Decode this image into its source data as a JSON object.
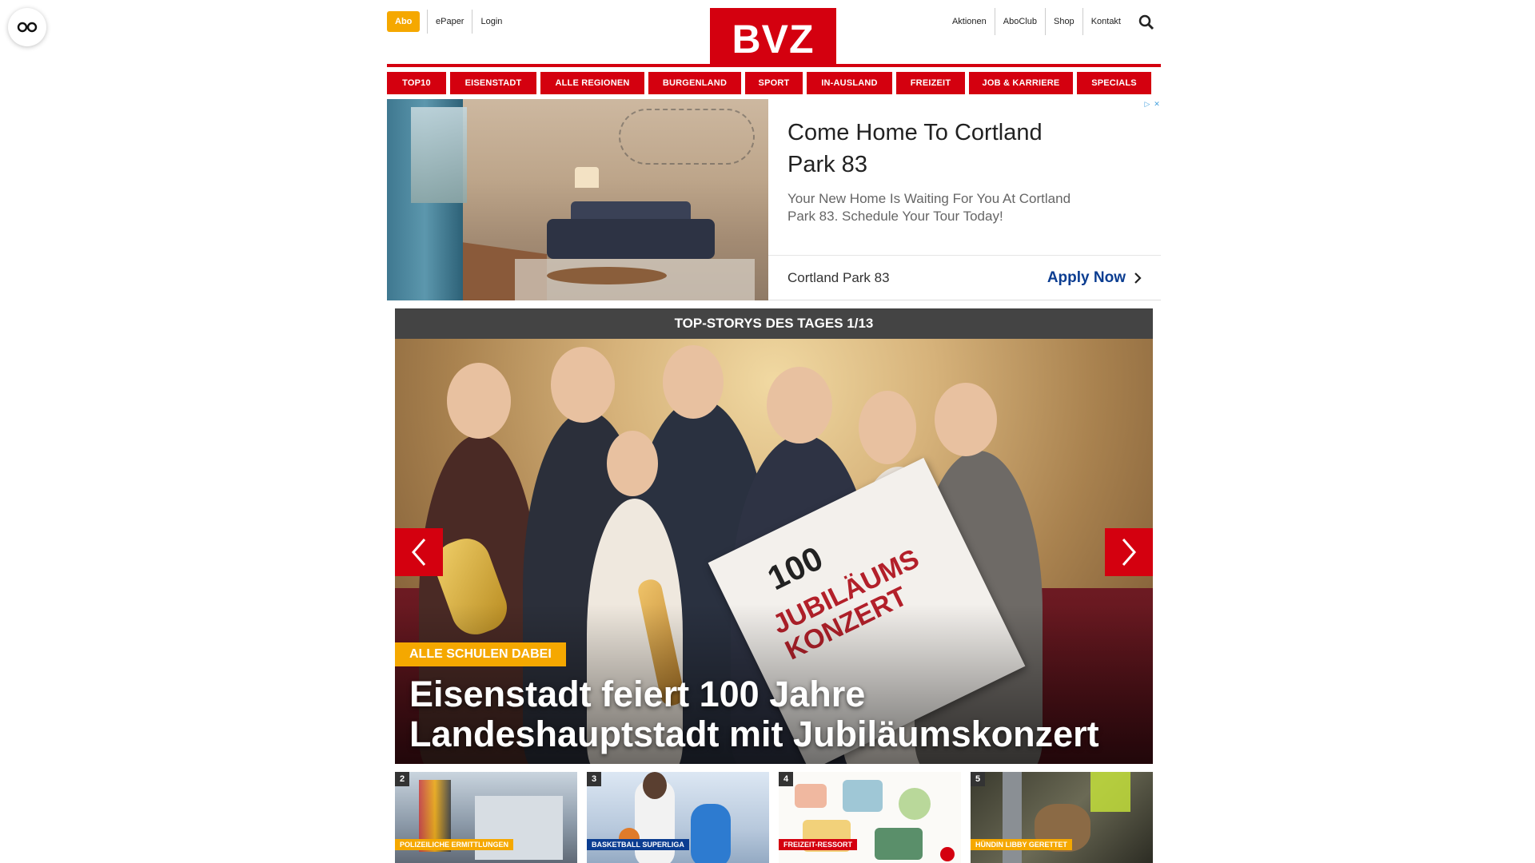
{
  "header": {
    "abo_label": "Abo",
    "left_links": [
      "ePaper",
      "Login"
    ],
    "logo_text": "BVZ",
    "right_links": [
      "Aktionen",
      "AboClub",
      "Shop",
      "Kontakt"
    ],
    "search_icon": "search-icon"
  },
  "nav": {
    "items": [
      "TOP10",
      "EISENSTADT",
      "ALLE REGIONEN",
      "BURGENLAND",
      "SPORT",
      "IN-AUSLAND",
      "FREIZEIT",
      "JOB & KARRIERE",
      "SPECIALS"
    ]
  },
  "ad": {
    "title": "Come Home To Cortland Park 83",
    "description": "Your New Home Is Waiting For You At Cortland Park 83. Schedule Your Tour Today!",
    "brand": "Cortland Park 83",
    "cta": "Apply Now"
  },
  "top_stories": {
    "heading": "TOP-STORYS DES TAGES 1/13",
    "hero": {
      "kicker": "ALLE SCHULEN DABEI",
      "headline": "Eisenstadt feiert 100 Jahre Landeshauptstadt mit Jubiläumskonzert",
      "poster_number": "100",
      "poster_title": "JUBILÄUMS KONZERT"
    },
    "thumbnails": [
      {
        "number": "2",
        "tag": "POLIZEILICHE ERMITTLUNGEN",
        "tag_color": "#f5a800"
      },
      {
        "number": "3",
        "tag": "BASKETBALL SUPERLIGA",
        "tag_color": "#0b3d91"
      },
      {
        "number": "4",
        "tag": "FREIZEIT-RESSORT",
        "tag_color": "#d4000f"
      },
      {
        "number": "5",
        "tag": "HÜNDIN LIBBY GERETTET",
        "tag_color": "#f5a800"
      }
    ]
  },
  "colors": {
    "brand_red": "#d4000f",
    "accent_yellow": "#f5a800",
    "cta_blue": "#0b3d91"
  }
}
